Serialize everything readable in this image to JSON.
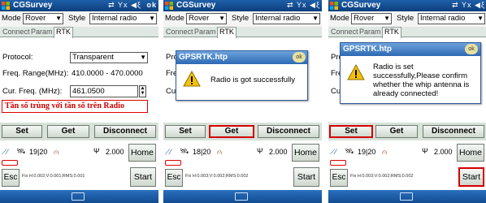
{
  "app": {
    "title": "CGSurvey",
    "ok_label": "ok"
  },
  "mode": {
    "label": "Mode",
    "value": "Rover"
  },
  "style": {
    "label": "Style",
    "value": "Internal radio"
  },
  "tabs": [
    "Connect",
    "Param",
    "RTK"
  ],
  "form": {
    "protocol_label": "Protocol:",
    "protocol_value": "Transparent",
    "freq_range_label": "Freq. Range(MHz):",
    "freq_range_value": "410.0000 - 470.0000",
    "cur_freq_label": "Cur. Freq. (MHz):",
    "cur_freq_value": "461.0500"
  },
  "note": "Tần số trùng với tần số trên Radio",
  "buttons": {
    "set": "Set",
    "get": "Get",
    "disconnect": "Disconnect",
    "home": "Home",
    "start": "Start",
    "esc": "Esc"
  },
  "status": [
    {
      "sats": "19|20",
      "signal": "2.000",
      "coords": "Fix H:0.002;V:0.001;RMS:0.001"
    },
    {
      "sats": "18|20",
      "signal": "2.000",
      "coords": "Fix H:0.003;V:0.002;RMS:0.002"
    },
    {
      "sats": "19|20",
      "signal": "2.000",
      "coords": "Fix H:0.003;V:0.002;RMS:0.002"
    }
  ],
  "dialogs": [
    {
      "title": "GPSRTK.htp",
      "ok": "ok",
      "message": "Radio is got successfully"
    },
    {
      "title": "GPSRTK.htp",
      "ok": "ok",
      "message": "Radio is set successfully,Please confirm whether the whip antenna is already connected!"
    }
  ],
  "partial_labels": {
    "pro": "Pro",
    "fre": "Fre",
    "cur": "Cur"
  },
  "colors": {
    "title_bar": "#0c3f7d",
    "highlight": "#d40000",
    "note_text": "#d00000",
    "tab_bg": "#dfe8e2"
  }
}
